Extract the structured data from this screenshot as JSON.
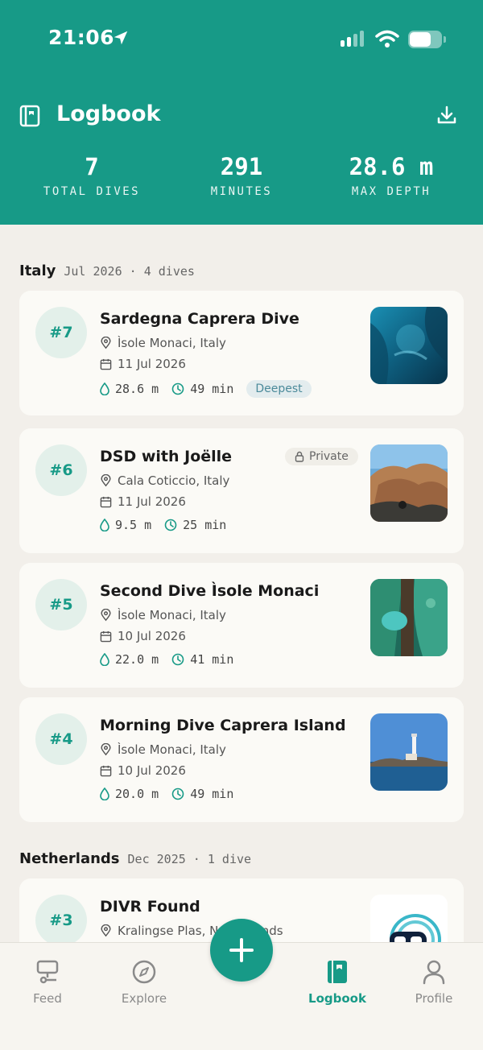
{
  "status_bar": {
    "time": "21:06"
  },
  "header": {
    "title": "Logbook",
    "icons": {
      "book": "logbook-icon",
      "download": "download-icon"
    },
    "stats": [
      {
        "value": "7",
        "label": "TOTAL DIVES"
      },
      {
        "value": "291",
        "label": "MINUTES"
      },
      {
        "value": "28.6 m",
        "label": "MAX DEPTH"
      }
    ]
  },
  "sections": [
    {
      "country": "Italy",
      "meta": "Jul 2026 · 4 dives",
      "dives": [
        {
          "number": "#7",
          "title": "Sardegna Caprera Dive",
          "location": "Ìsole Monaci, Italy",
          "date": "11 Jul 2026",
          "depth": "28.6 m",
          "duration": "49 min",
          "badge": "Deepest"
        },
        {
          "number": "#6",
          "title": "DSD with Joëlle",
          "location": "Cala Coticcio, Italy",
          "date": "11 Jul 2026",
          "depth": "9.5 m",
          "duration": "25 min",
          "badge": "Private"
        },
        {
          "number": "#5",
          "title": "Second Dive Ìsole Monaci",
          "location": "Ìsole Monaci, Italy",
          "date": "10 Jul 2026",
          "depth": "22.0 m",
          "duration": "41 min"
        },
        {
          "number": "#4",
          "title": "Morning Dive Caprera Island",
          "location": "Ìsole Monaci, Italy",
          "date": "10 Jul 2026",
          "depth": "20.0 m",
          "duration": "49 min"
        }
      ]
    },
    {
      "country": "Netherlands",
      "meta": "Dec 2025 · 1 dive",
      "dives": [
        {
          "number": "#3",
          "title": "DIVR Found",
          "location": "Kralingse Plas, Netherlands"
        }
      ]
    }
  ],
  "tabbar": {
    "tabs": [
      {
        "label": "Feed",
        "icon": "feed-icon"
      },
      {
        "label": "Explore",
        "icon": "compass-icon"
      },
      {
        "label": "Logbook",
        "icon": "logbook-icon",
        "active": true
      },
      {
        "label": "Profile",
        "icon": "profile-icon"
      }
    ],
    "fab_icon": "plus-icon"
  },
  "colors": {
    "primary": "#179a87",
    "background": "#f2efea",
    "card": "#fbfaf6"
  }
}
